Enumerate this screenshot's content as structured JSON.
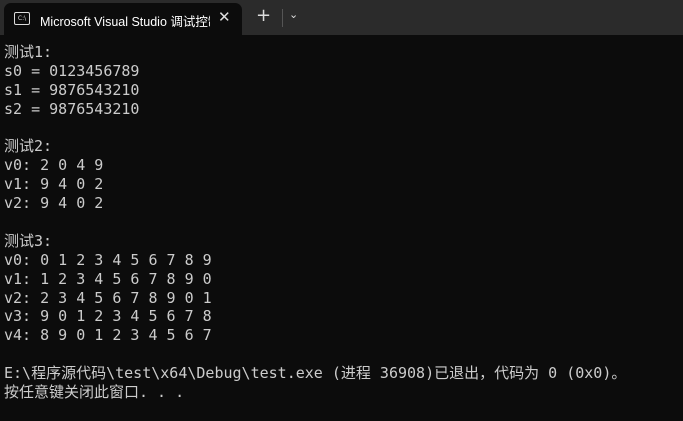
{
  "window": {
    "tab_title": "Microsoft Visual Studio 调试控制台",
    "icon_text": "C:\\",
    "close_glyph": "✕",
    "new_tab_glyph": "+",
    "dropdown_glyph": "⌄"
  },
  "console": {
    "lines": [
      "测试1:",
      "s0 = 0123456789",
      "s1 = 9876543210",
      "s2 = 9876543210",
      "",
      "测试2:",
      "v0: 2 0 4 9",
      "v1: 9 4 0 2",
      "v2: 9 4 0 2",
      "",
      "测试3:",
      "v0: 0 1 2 3 4 5 6 7 8 9",
      "v1: 1 2 3 4 5 6 7 8 9 0",
      "v2: 2 3 4 5 6 7 8 9 0 1",
      "v3: 9 0 1 2 3 4 5 6 7 8",
      "v4: 8 9 0 1 2 3 4 5 6 7",
      "",
      "E:\\程序源代码\\test\\x64\\Debug\\test.exe (进程 36908)已退出，代码为 0 (0x0)。",
      "按任意键关闭此窗口. . ."
    ]
  }
}
